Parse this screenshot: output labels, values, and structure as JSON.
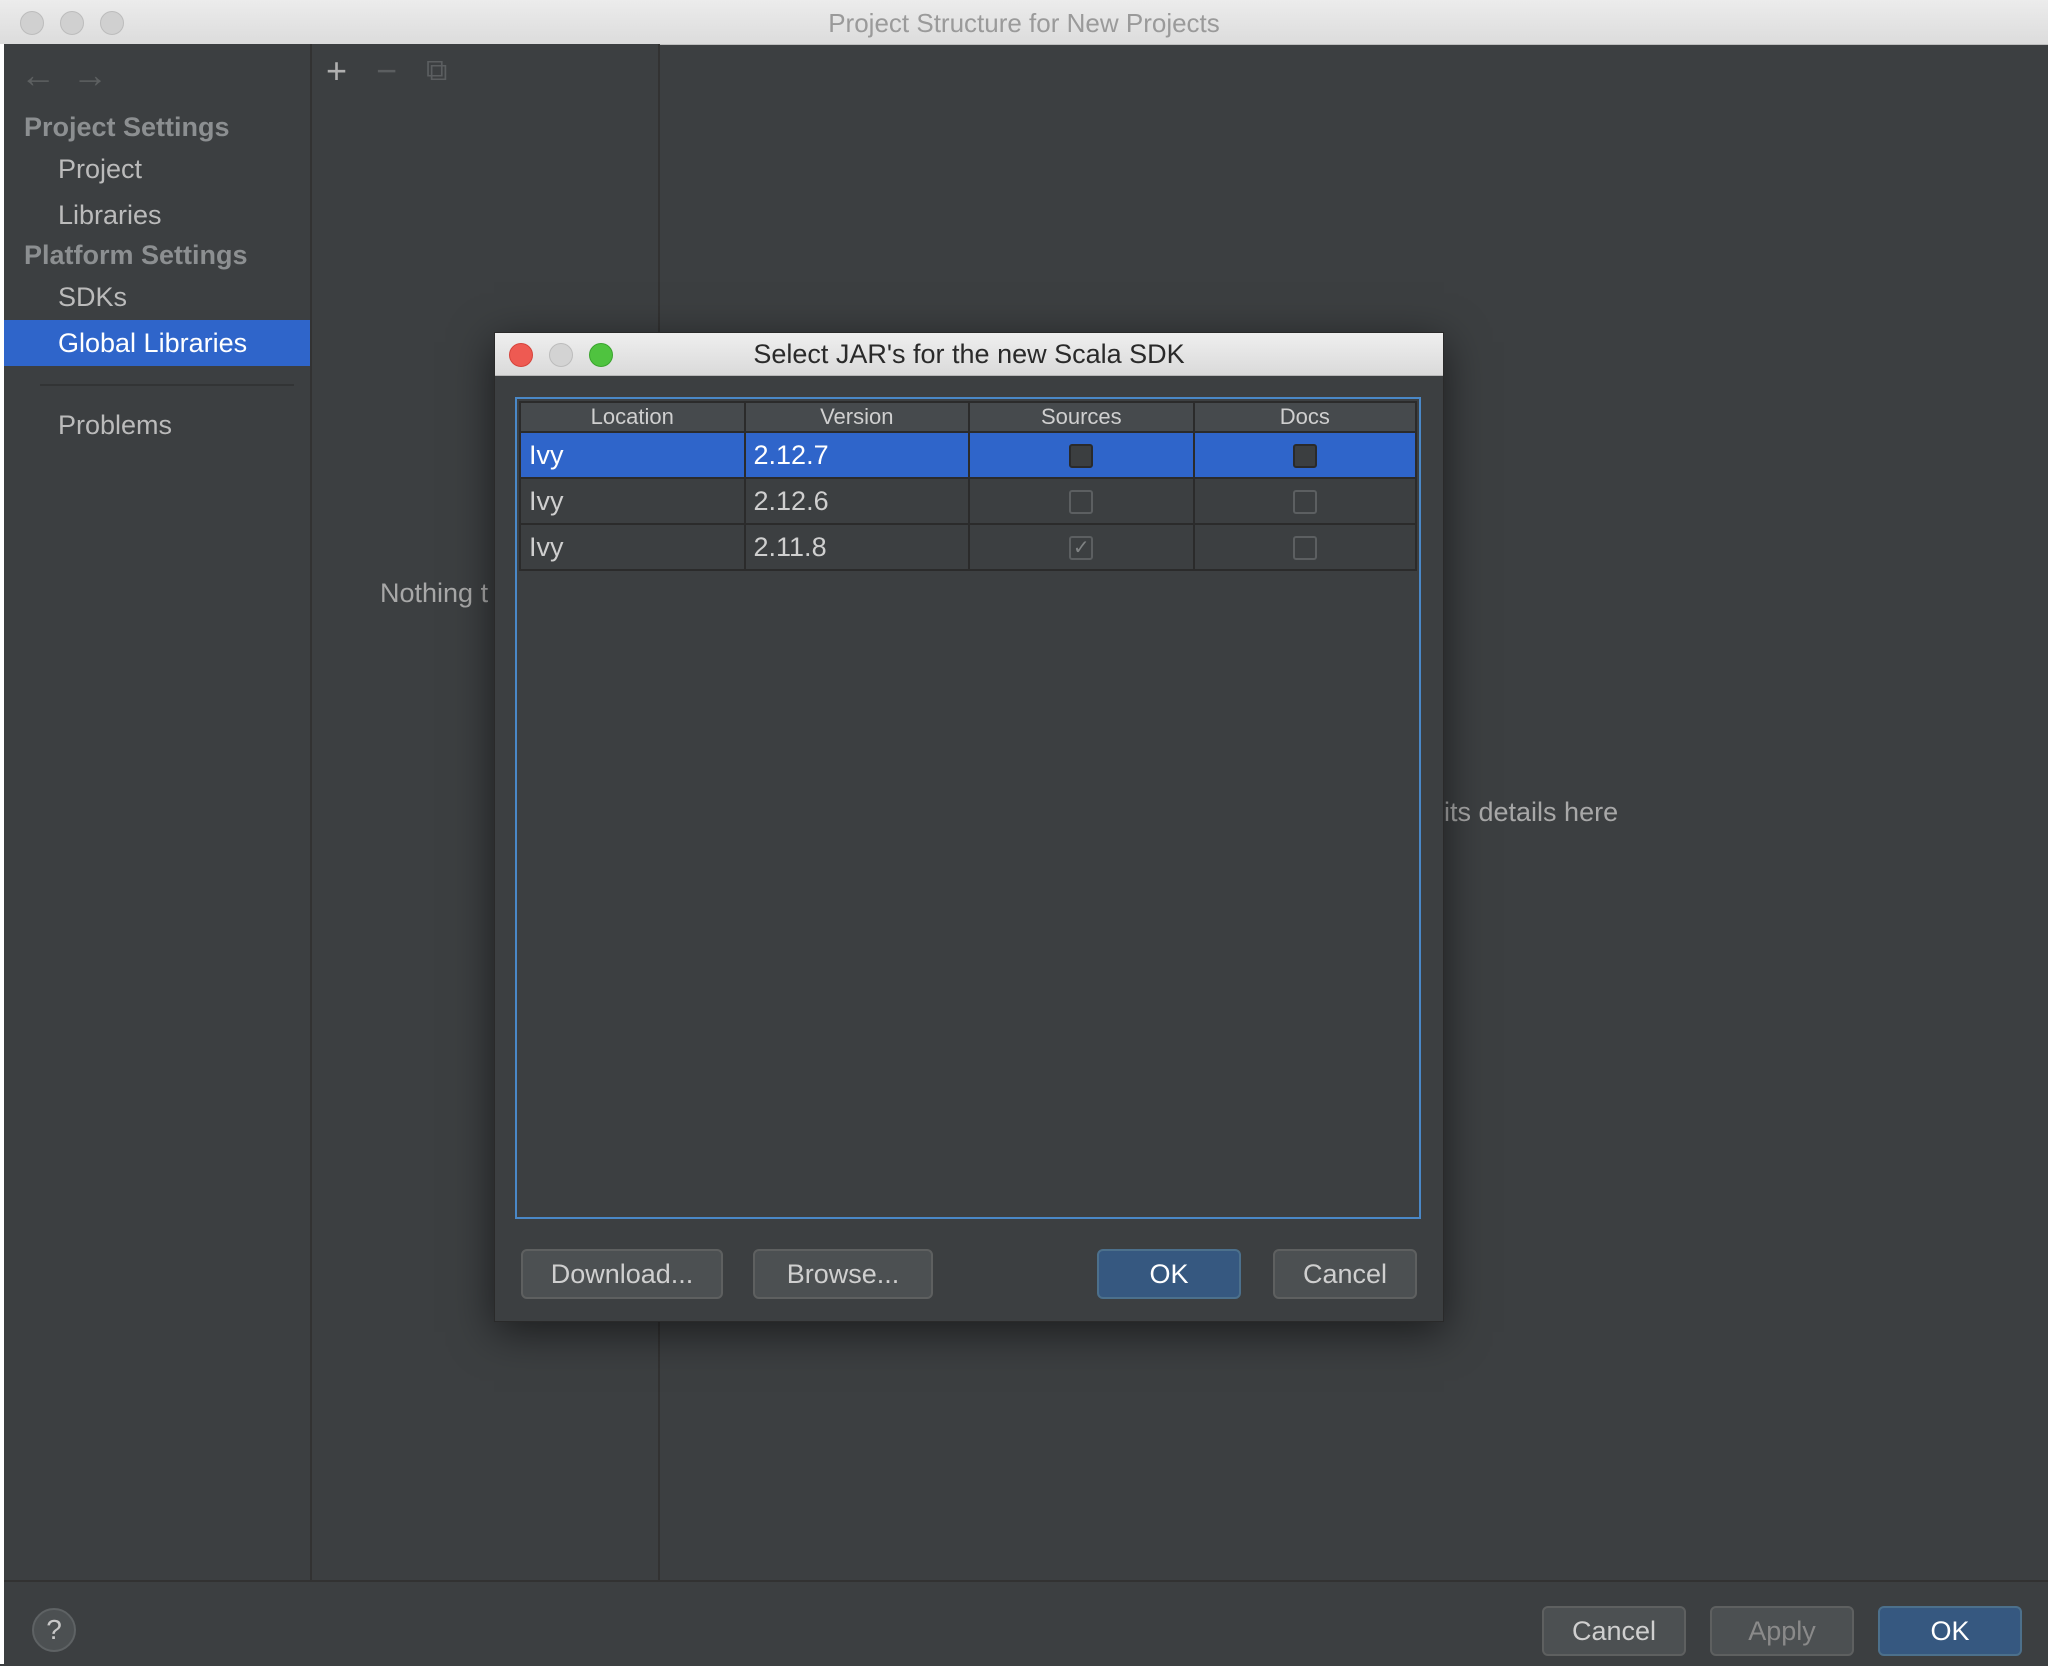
{
  "window": {
    "title": "Project Structure for New Projects"
  },
  "nav": {
    "back_icon": "←",
    "forward_icon": "→"
  },
  "sidebar": {
    "project_settings_header": "Project Settings",
    "platform_settings_header": "Platform Settings",
    "items": [
      {
        "label": "Project"
      },
      {
        "label": "Libraries"
      },
      {
        "label": "SDKs"
      },
      {
        "label": "Global Libraries"
      },
      {
        "label": "Problems"
      }
    ]
  },
  "toolbar": {
    "add_icon": "+",
    "remove_icon": "−",
    "copy_icon": "⧉"
  },
  "middle": {
    "empty_text": "Nothing t"
  },
  "details": {
    "hint_text": "its details here"
  },
  "dialog": {
    "title": "Select JAR's for the new Scala SDK",
    "columns": [
      "Location",
      "Version",
      "Sources",
      "Docs"
    ],
    "rows": [
      {
        "location": "Ivy",
        "version": "2.12.7",
        "sources": false,
        "docs": false,
        "selected": true
      },
      {
        "location": "Ivy",
        "version": "2.12.6",
        "sources": false,
        "docs": false,
        "selected": false
      },
      {
        "location": "Ivy",
        "version": "2.11.8",
        "sources": true,
        "docs": false,
        "selected": false
      }
    ],
    "buttons": {
      "download": "Download...",
      "browse": "Browse...",
      "ok": "OK",
      "cancel": "Cancel"
    }
  },
  "footer": {
    "help": "?",
    "cancel": "Cancel",
    "apply": "Apply",
    "ok": "OK"
  },
  "colors": {
    "selection": "#2f65ca",
    "primary_button": "#365880",
    "background": "#3c3f41"
  }
}
